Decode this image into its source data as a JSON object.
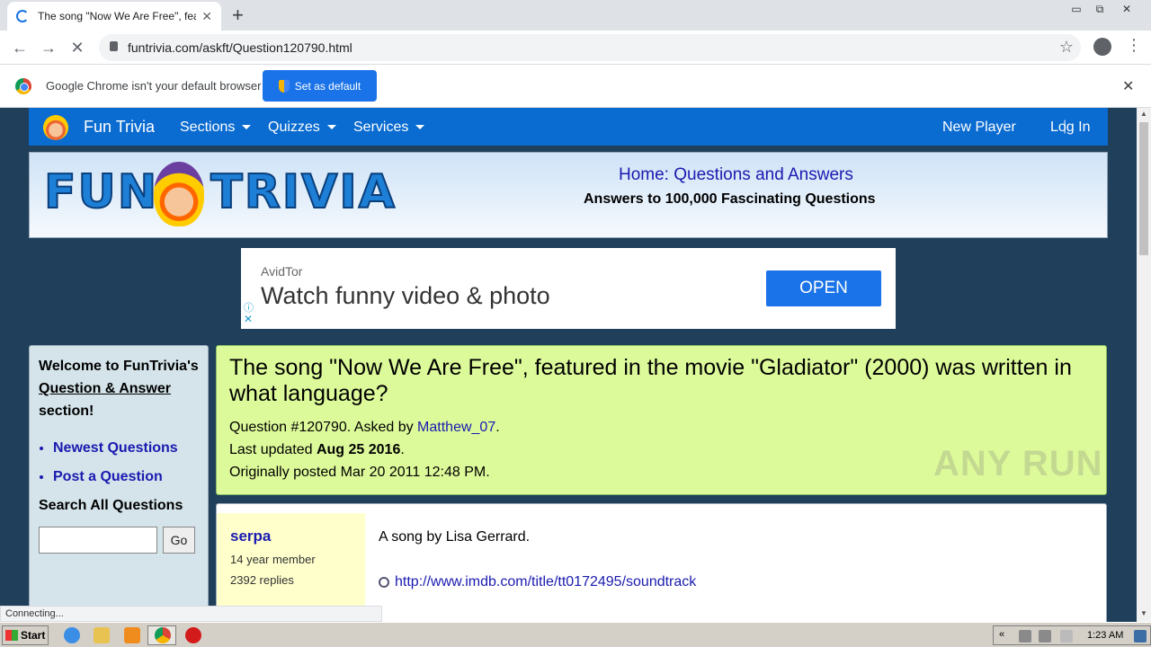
{
  "browser": {
    "tab_title": "The song \"Now We Are Free\", featu",
    "tab_close": "✕",
    "new_tab": "+",
    "url": "funtrivia.com/askft/Question120790.html",
    "infobar_message": "Google Chrome isn't your default browser",
    "infobar_button": "Set as default",
    "infobar_close": "✕",
    "status_text": "Connecting...",
    "window_controls": [
      "▭",
      "⧉",
      "✕"
    ],
    "icons": {
      "back": "←",
      "forward": "→",
      "stop": "✕",
      "star": "☆",
      "menu": "⋮"
    }
  },
  "site": {
    "nav": {
      "brand": "Fun Trivia",
      "items": [
        "Sections",
        "Quizzes",
        "Services"
      ],
      "new_player": "New Player",
      "separator": "|",
      "log_in": "Log In"
    },
    "banner": {
      "logo_left": "FUN",
      "logo_right": "TRIVIA",
      "home_prefix": "Home:",
      "home_link": "Questions and Answers",
      "tagline": "Answers to 100,000 Fascinating Questions"
    },
    "ad": {
      "advertiser": "AvidTor",
      "headline": "Watch funny video & photo",
      "button": "OPEN",
      "info_icon": "ⓘ",
      "close_icon": "✕"
    },
    "sidebar": {
      "welcome_1": "Welcome to FunTrivia's ",
      "welcome_link": "Question & Answer",
      "welcome_2": " section!",
      "links": [
        "Newest Questions",
        "Post a Question"
      ],
      "search_title": "Search All Questions",
      "search_button": "Go",
      "search_value": ""
    },
    "question": {
      "title": "The song \"Now We Are Free\", featured in the movie \"Gladiator\" (2000) was written in what language?",
      "number_text": "Question #120790. Asked by ",
      "asker": "Matthew_07",
      "period": ".",
      "updated_label": "Last updated ",
      "updated_date": "Aug 25 2016",
      "posted": "Originally posted Mar 20 2011 12:48 PM."
    },
    "answer": {
      "username": "serpa",
      "membership": "14 year member",
      "replies": "2392 replies",
      "text": "A song by Lisa Gerrard.",
      "link": "http://www.imdb.com/title/tt0172495/soundtrack"
    },
    "watermark": "ANY RUN"
  },
  "taskbar": {
    "start": "Start",
    "clock": "1:23 AM",
    "tray_arrows": "«"
  },
  "colors": {
    "nav_blue": "#0a6bd1",
    "page_bg": "#1f3f5b",
    "question_bg": "#ddfa9a",
    "user_bg": "#ffffcc",
    "link": "#1a1ab0",
    "chrome_blue": "#1a73e8"
  }
}
